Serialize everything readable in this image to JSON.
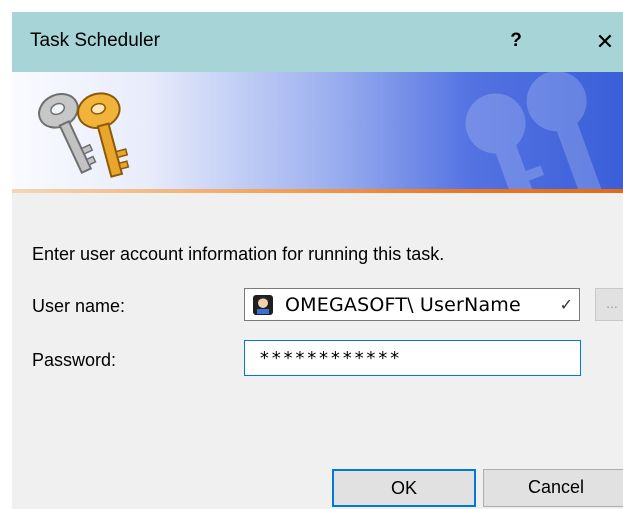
{
  "window": {
    "title": "Task Scheduler",
    "help_label": "?",
    "close_label": "✕"
  },
  "prompt": "Enter user account information for running this task.",
  "fields": {
    "user_label": "User name:",
    "user_value": "OMEGASOFT\\ UserName",
    "password_label": "Password:",
    "password_value": "************",
    "browse_label": "..."
  },
  "buttons": {
    "ok": "OK",
    "cancel": "Cancel"
  },
  "colors": {
    "titlebar": "#a7d4d6",
    "accent": "#0078d7",
    "banner_blue": "#3a5fd8",
    "banner_orange": "#ee7a24"
  }
}
